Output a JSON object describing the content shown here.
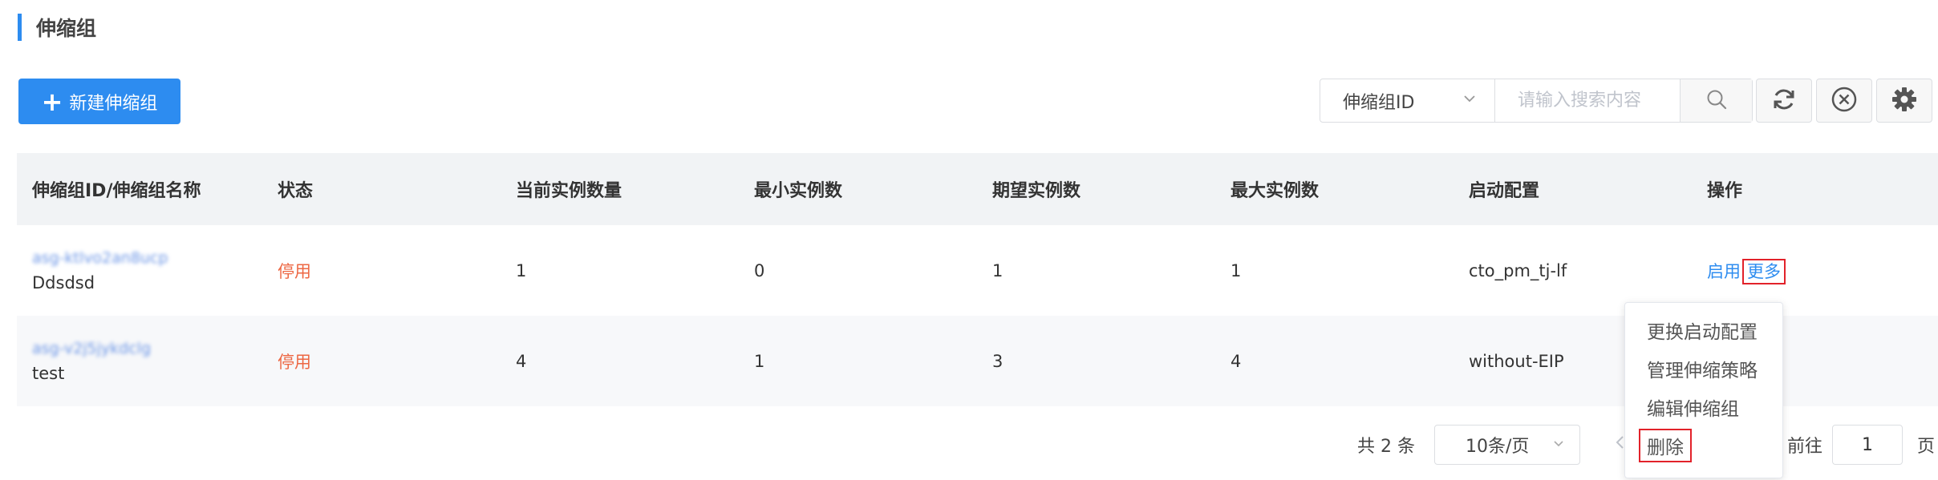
{
  "page": {
    "title": "伸缩组"
  },
  "toolbar": {
    "create_label": "新建伸缩组"
  },
  "search": {
    "field_selected": "伸缩组ID",
    "placeholder": "请输入搜索内容"
  },
  "table": {
    "headers": [
      "伸缩组ID/伸缩组名称",
      "状态",
      "当前实例数量",
      "最小实例数",
      "期望实例数",
      "最大实例数",
      "启动配置",
      "操作"
    ],
    "rows": [
      {
        "id": "asg-ktlvo2an8ucp",
        "name": "Ddsdsd",
        "status": "停用",
        "current": "1",
        "min": "0",
        "desired": "1",
        "max": "1",
        "launch_config": "cto_pm_tj-lf",
        "action_enable": "启用",
        "action_more": "更多"
      },
      {
        "id": "asg-v2j5jykdclg",
        "name": "test",
        "status": "停用",
        "current": "4",
        "min": "1",
        "desired": "3",
        "max": "4",
        "launch_config": "without-EIP"
      }
    ]
  },
  "more_menu": {
    "items": [
      "更换启动配置",
      "管理伸缩策略",
      "编辑伸缩组",
      "删除"
    ]
  },
  "pagination": {
    "total_text": "共 2 条",
    "page_size": "10条/页",
    "goto_prefix": "前往",
    "goto_value": "1",
    "goto_suffix": "页"
  },
  "colors": {
    "primary": "#2d8cf0",
    "status_off": "#ed6743",
    "highlight": "#e2222a"
  },
  "icons": [
    "plus-icon",
    "chevron-down-icon",
    "search-icon",
    "refresh-icon",
    "clear-circle-icon",
    "gear-icon",
    "chevron-left-icon"
  ]
}
